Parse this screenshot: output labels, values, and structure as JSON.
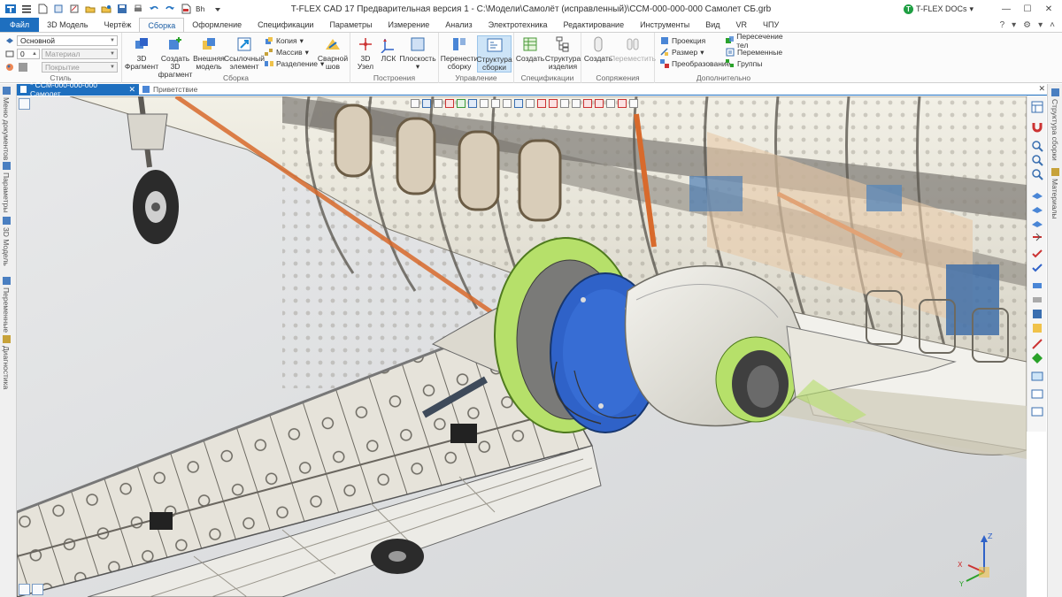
{
  "window": {
    "title": "T-FLEX CAD 17 Предварительная версия 1 - C:\\Модели\\Самолёт (исправленный)\\ССМ-000-000-000 Самолет СБ.grb",
    "docs_label": "T-FLEX DOCs",
    "docs_logo_letter": "T"
  },
  "tabs": [
    {
      "label": "Файл"
    },
    {
      "label": "3D Модель"
    },
    {
      "label": "Чертёж"
    },
    {
      "label": "Сборка"
    },
    {
      "label": "Оформление"
    },
    {
      "label": "Спецификации"
    },
    {
      "label": "Параметры"
    },
    {
      "label": "Измерение"
    },
    {
      "label": "Анализ"
    },
    {
      "label": "Электротехника"
    },
    {
      "label": "Редактирование"
    },
    {
      "label": "Инструменты"
    },
    {
      "label": "Вид"
    },
    {
      "label": "VR"
    },
    {
      "label": "ЧПУ"
    }
  ],
  "ribbon": {
    "style": {
      "label": "Стиль",
      "layer_value": "Основной",
      "level_value": "0",
      "material_placeholder": "Материал",
      "coating_placeholder": "Покрытие"
    },
    "assembly": {
      "label": "Сборка",
      "fragment_3d": "3D\nФрагмент",
      "create_fragment": "Создать 3D\nфрагмент",
      "external_model": "Внешняя\nмодель",
      "reference_element": "Ссылочный\nэлемент",
      "copy": "Копия",
      "array": "Массив",
      "split": "Разделение",
      "weld": "Сварной\nшов"
    },
    "constructions": {
      "label": "Построения",
      "node_3d": "3D\nУзел",
      "lcs": "ЛСК",
      "plane": "Плоскость"
    },
    "management": {
      "label": "Управление",
      "rearrange": "Перенести\nсборку",
      "structure": "Структура\nсборки"
    },
    "specifications": {
      "label": "Спецификации",
      "create": "Создать",
      "product_structure": "Структура\nизделия"
    },
    "mates": {
      "label": "Сопряжения",
      "create": "Создать",
      "move": "Переместить"
    },
    "additional": {
      "label": "Дополнительно",
      "projection": "Проекция",
      "size": "Размер",
      "transform": "Преобразование",
      "body_intersection": "Пересечение тел",
      "variables": "Переменные",
      "groups": "Группы"
    }
  },
  "doc_tabs": [
    {
      "label": "* ССМ-000-000-000 Самолет ...",
      "active": true
    },
    {
      "label": "Приветствие",
      "active": false
    }
  ],
  "left_panels": [
    {
      "label": "Меню документов"
    },
    {
      "label": "Параметры"
    },
    {
      "label": "3D Модель"
    },
    {
      "label": "Переменные"
    },
    {
      "label": "Диагностика"
    }
  ],
  "right_panels": [
    {
      "label": "Структура сборки"
    },
    {
      "label": "Материалы"
    }
  ],
  "axis": {
    "z": "Z",
    "x": "X",
    "y": "Y"
  },
  "colors": {
    "accent": "#1e6fbf",
    "engine_green": "#b6e06a",
    "engine_blue": "#2f62c8",
    "spar_orange": "#d86a2c"
  }
}
